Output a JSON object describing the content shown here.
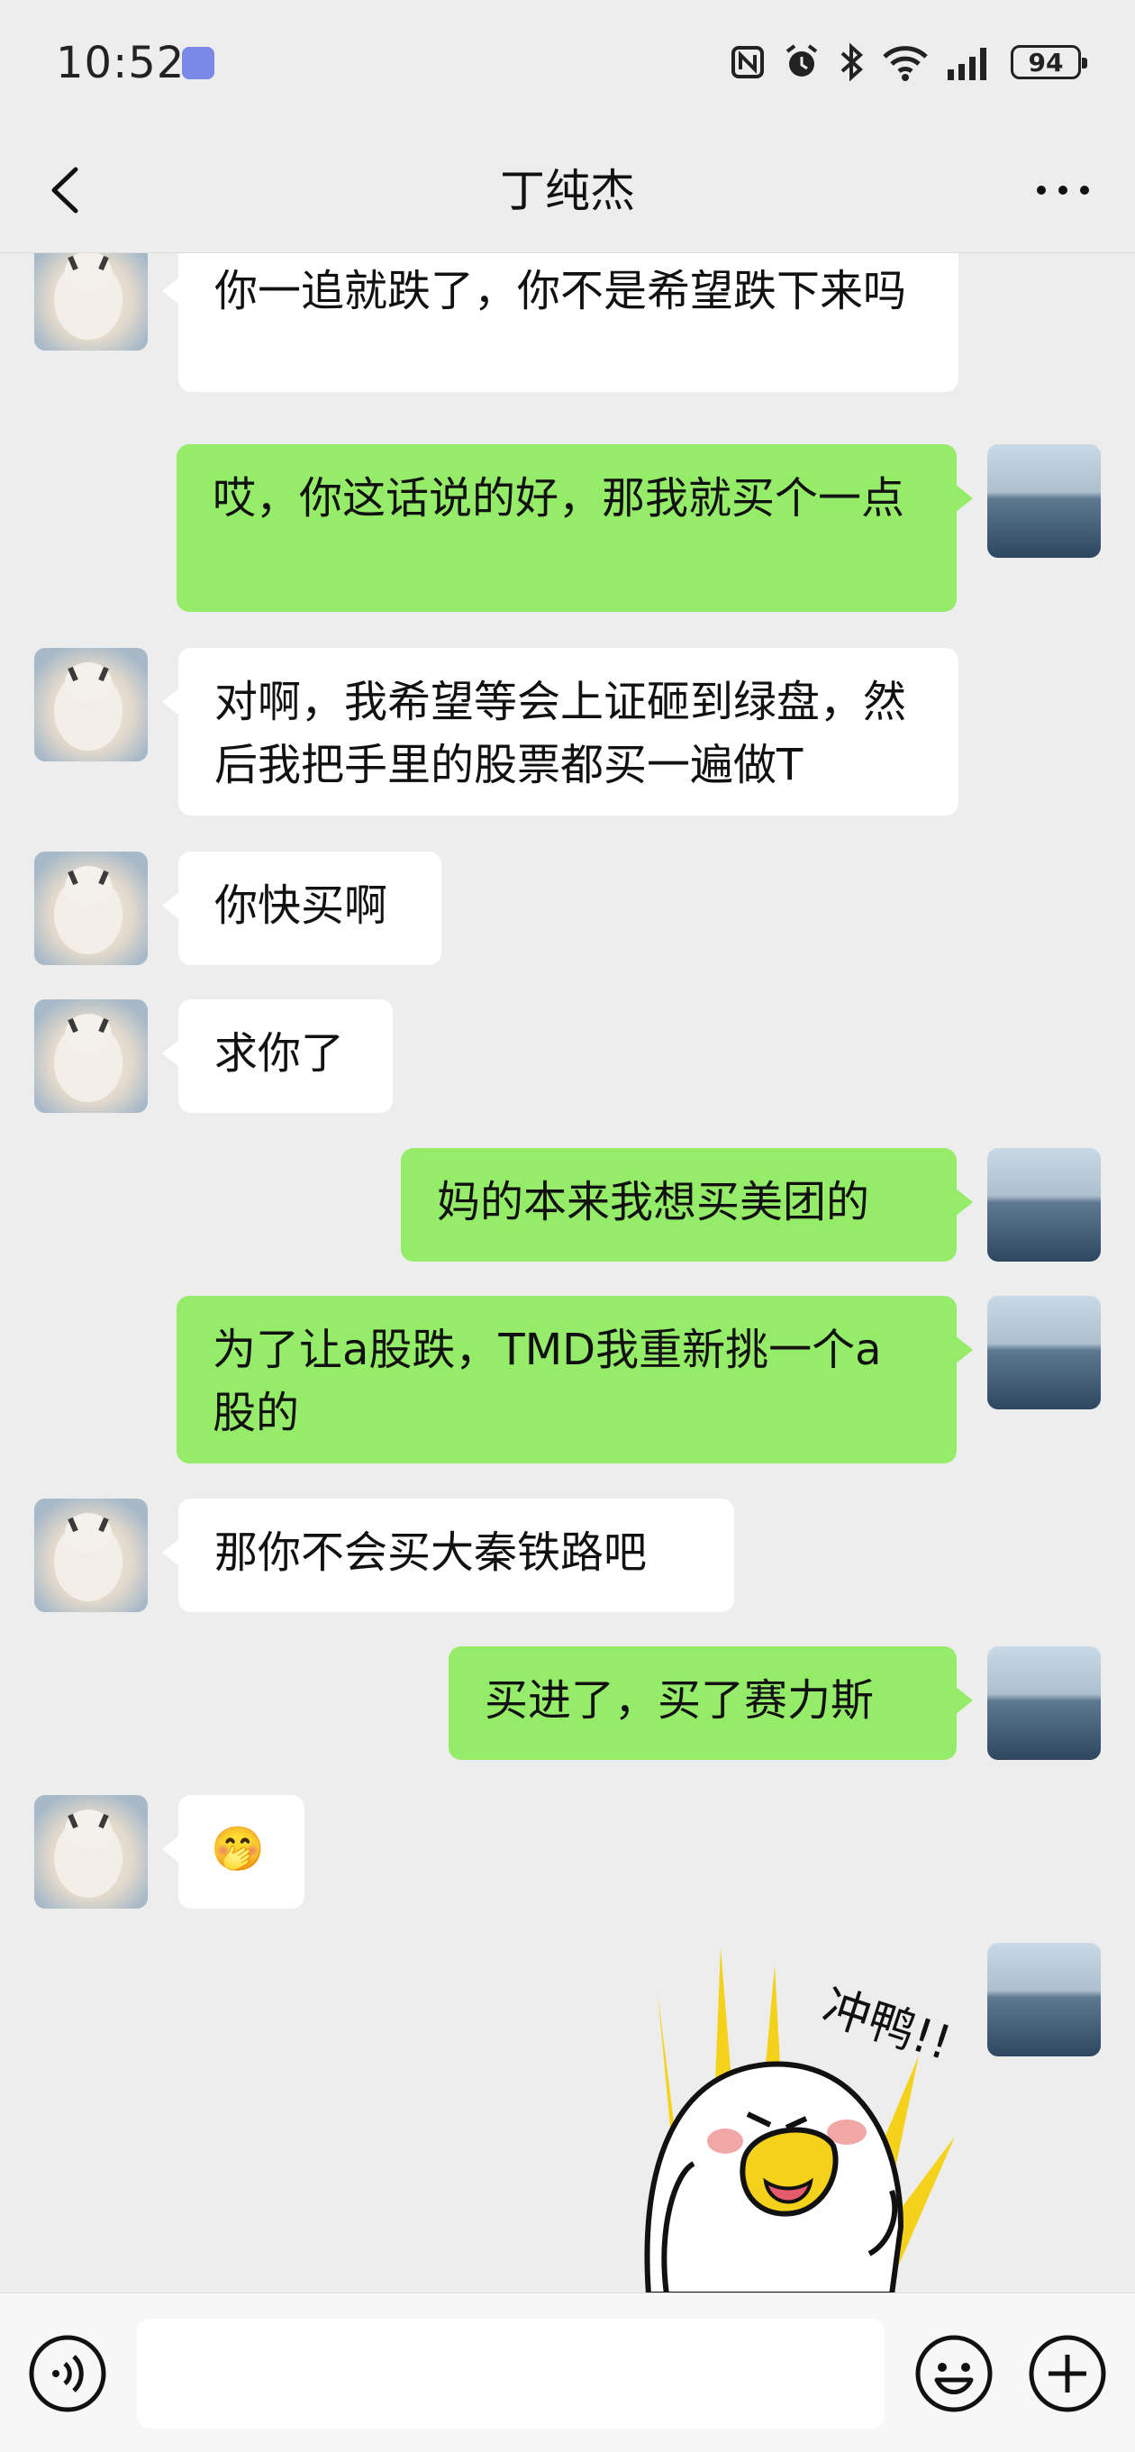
{
  "status_bar": {
    "time": "10:52",
    "battery": "94"
  },
  "header": {
    "title": "丁纯杰"
  },
  "messages": [
    {
      "side": "in",
      "text": "你一追就跌了，你不是希望跌下来吗"
    },
    {
      "side": "out",
      "text": "哎，你这话说的好，那我就买个一点"
    },
    {
      "side": "in",
      "text": "对啊，我希望等会上证砸到绿盘，然后我把手里的股票都买一遍做T"
    },
    {
      "side": "in",
      "text": "你快买啊"
    },
    {
      "side": "in",
      "text": "求你了"
    },
    {
      "side": "out",
      "text": "妈的本来我想买美团的"
    },
    {
      "side": "out",
      "text": "为了让a股跌，TMD我重新挑一个a股的"
    },
    {
      "side": "in",
      "text": "那你不会买大秦铁路吧"
    },
    {
      "side": "out",
      "text": "买进了，买了赛力斯"
    },
    {
      "side": "in",
      "text": "🤭"
    },
    {
      "side": "out",
      "text": "冲鸭!!",
      "type": "sticker"
    }
  ],
  "icons": [
    "back-icon",
    "more-icon",
    "voice-icon",
    "emoji-icon",
    "plus-icon",
    "nfc-icon",
    "alarm-icon",
    "bluetooth-icon",
    "wifi-icon",
    "signal-icon"
  ],
  "colors": {
    "background": "#ededed",
    "outgoing_bubble": "#95ec69",
    "incoming_bubble": "#ffffff"
  }
}
